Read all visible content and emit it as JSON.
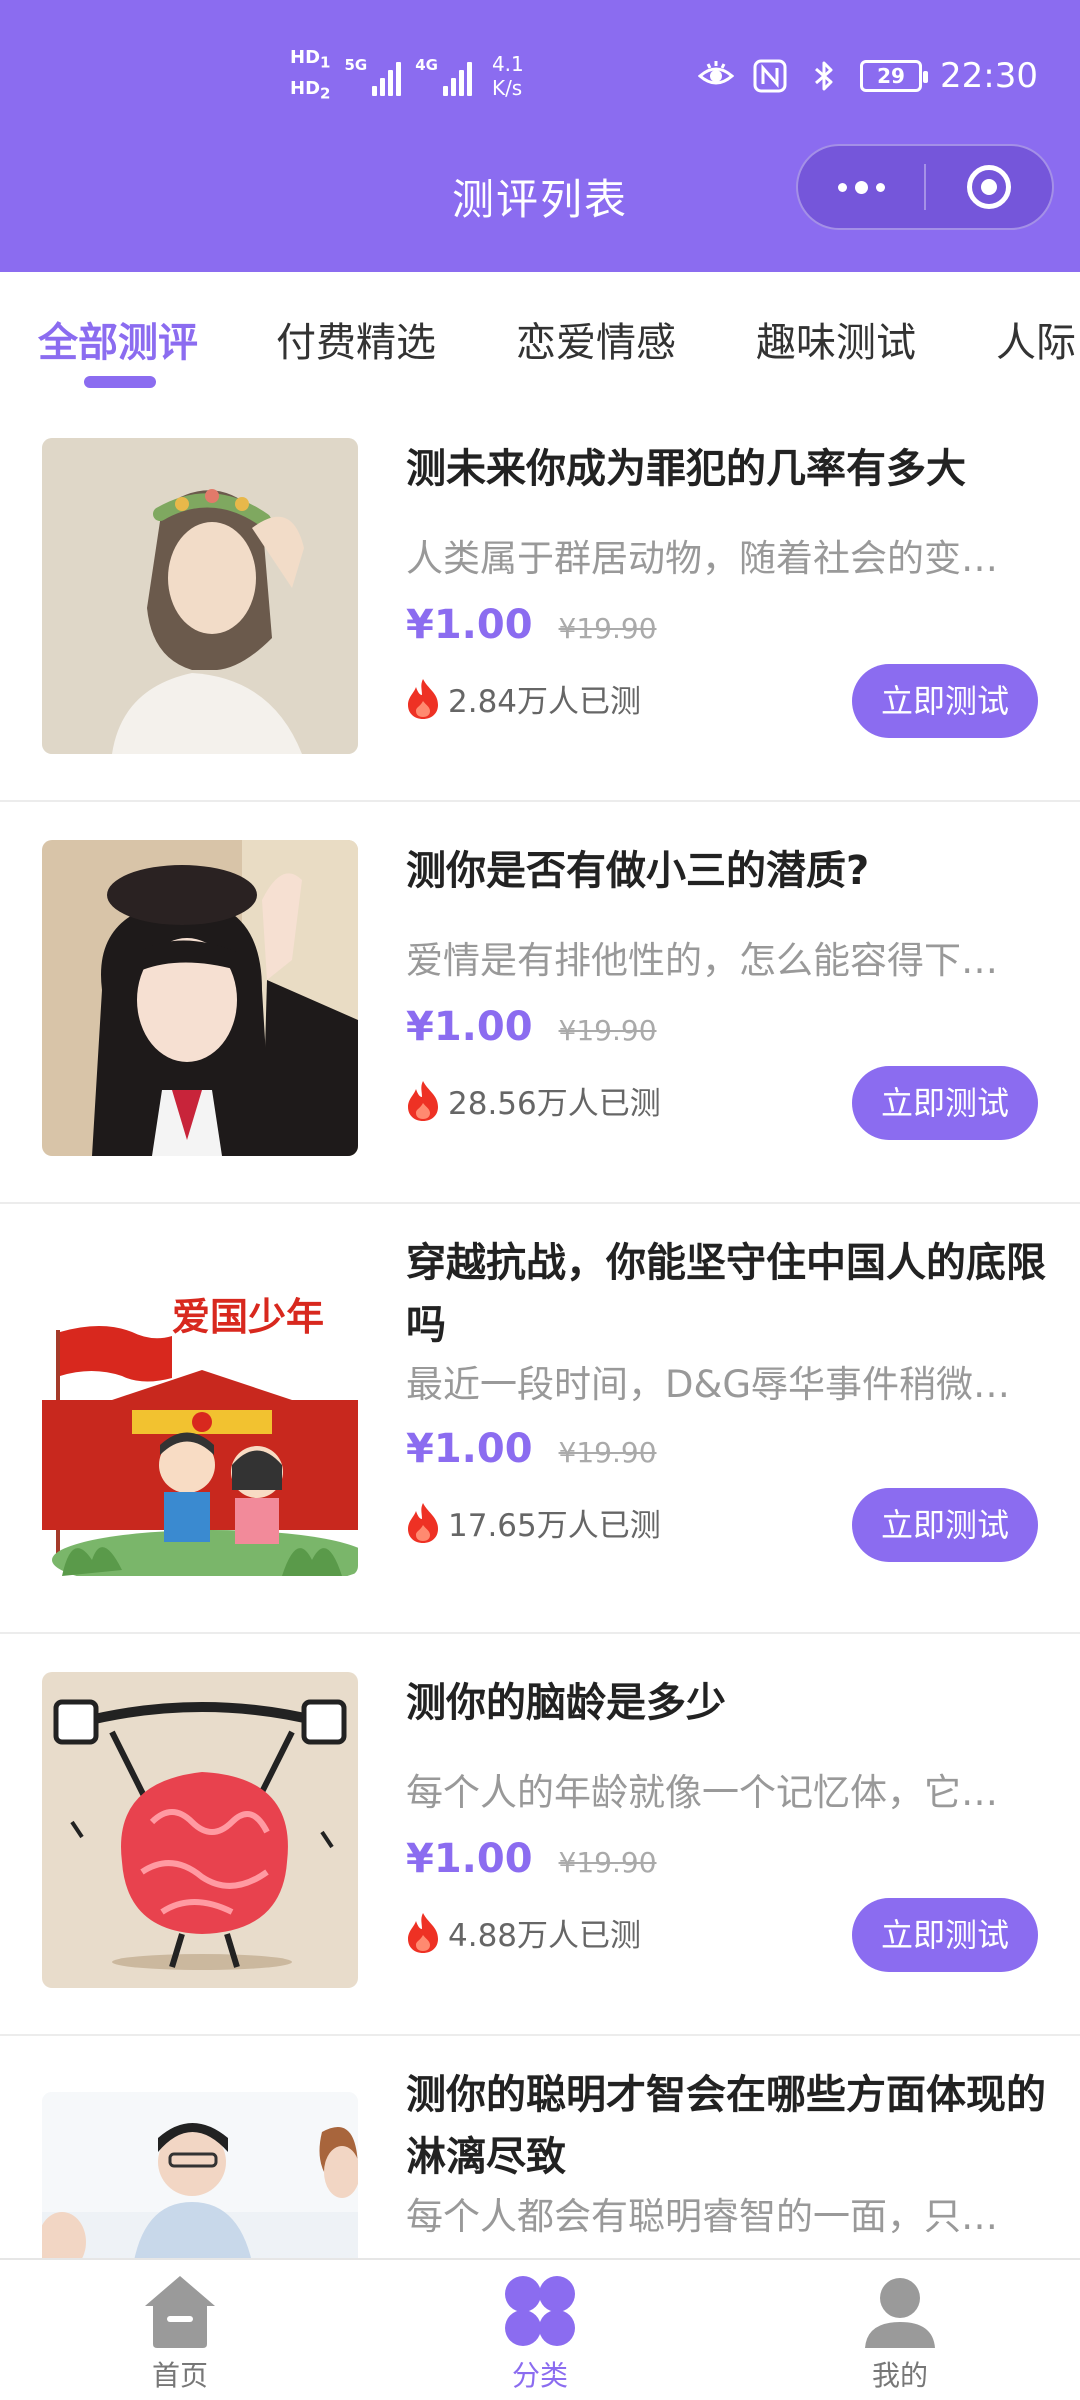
{
  "status_bar": {
    "hd1": "HD",
    "hd1_sub": "1",
    "hd2": "HD",
    "hd2_sub": "2",
    "sig1": "5G",
    "sig2": "4G",
    "speed_value": "4.1",
    "speed_unit": "K/s",
    "battery": "29",
    "time": "22:30"
  },
  "header": {
    "title": "测评列表"
  },
  "tabs": [
    {
      "label": "全部测评",
      "active": true
    },
    {
      "label": "付费精选",
      "active": false
    },
    {
      "label": "恋爱情感",
      "active": false
    },
    {
      "label": "趣味测试",
      "active": false
    },
    {
      "label": "人际",
      "active": false
    }
  ],
  "items": [
    {
      "title": "测未来你成为罪犯的几率有多大",
      "desc": "人类属于群居动物，随着社会的变…",
      "price": "¥1.00",
      "old_price": "¥19.90",
      "count": "2.84万人已测",
      "cta": "立即测试"
    },
    {
      "title": "测你是否有做小三的潜质?",
      "desc": "爱情是有排他性的，怎么能容得下…",
      "price": "¥1.00",
      "old_price": "¥19.90",
      "count": "28.56万人已测",
      "cta": "立即测试"
    },
    {
      "title": "穿越抗战，你能坚守住中国人的底限吗",
      "desc": "最近一段时间，D&G辱华事件稍微…",
      "price": "¥1.00",
      "old_price": "¥19.90",
      "count": "17.65万人已测",
      "cta": "立即测试",
      "thumb_text": "爱国少年"
    },
    {
      "title": "测你的脑龄是多少",
      "desc": "每个人的年龄就像一个记忆体，它…",
      "price": "¥1.00",
      "old_price": "¥19.90",
      "count": "4.88万人已测",
      "cta": "立即测试"
    },
    {
      "title": "测你的聪明才智会在哪些方面体现的淋漓尽致",
      "desc": "每个人都会有聪明睿智的一面，只…"
    }
  ],
  "bottom_nav": [
    {
      "label": "首页",
      "icon": "home-icon",
      "active": false
    },
    {
      "label": "分类",
      "icon": "category-icon",
      "active": true
    },
    {
      "label": "我的",
      "icon": "user-icon",
      "active": false
    }
  ],
  "colors": {
    "accent": "#8b6cf0",
    "fire": "#ee3124",
    "text_muted": "#999999"
  }
}
